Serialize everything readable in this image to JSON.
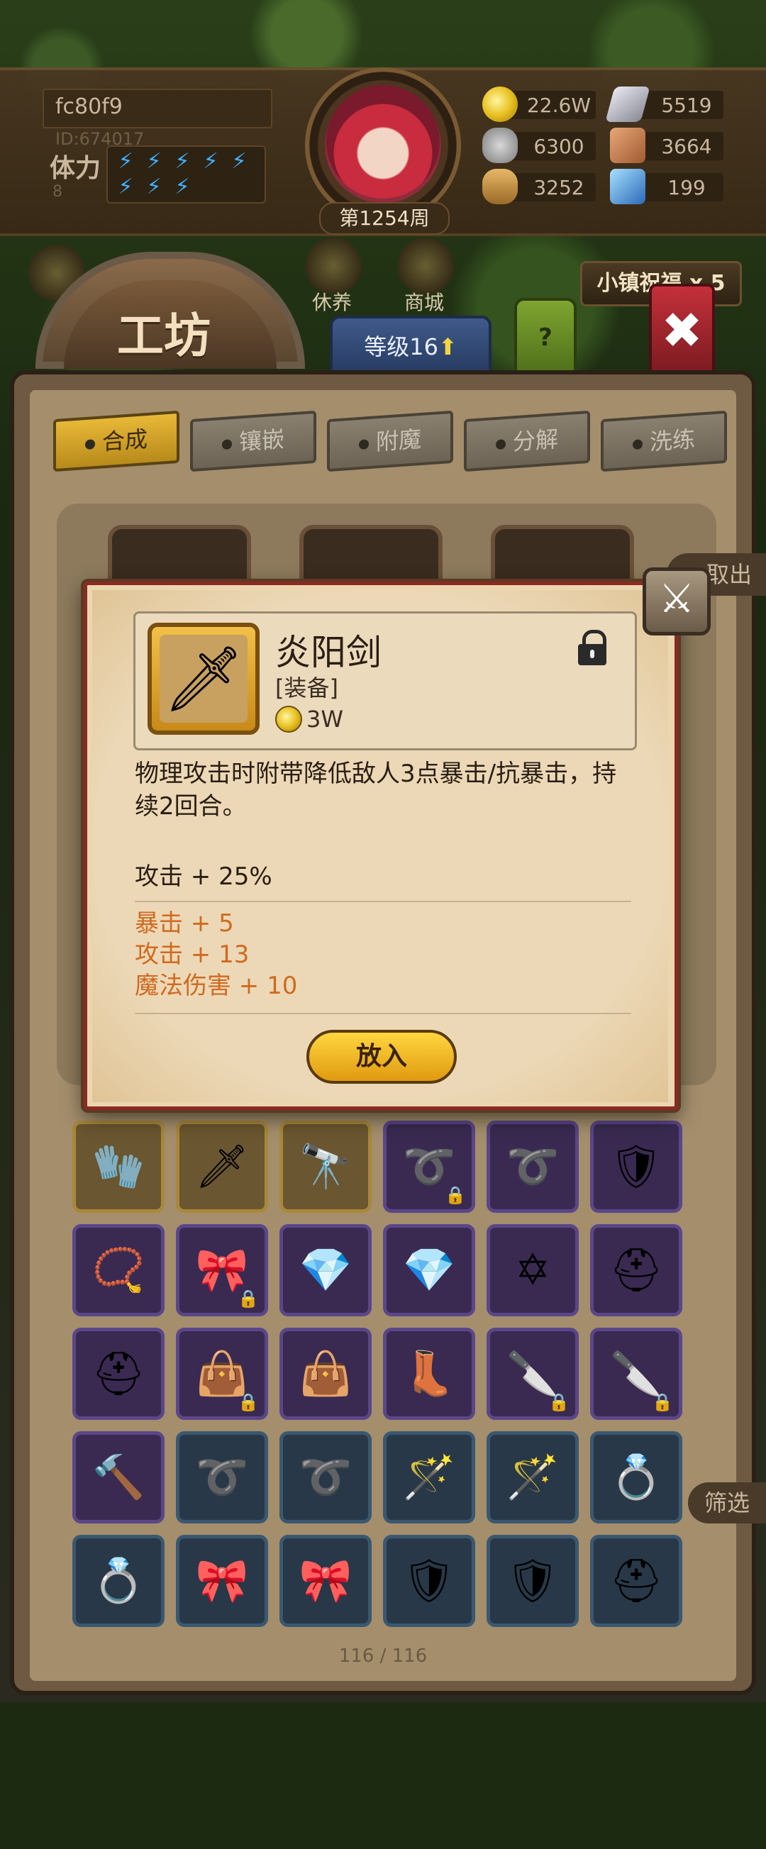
{
  "player": {
    "name": "fc80f9",
    "id_text": "ID:674017",
    "stamina_label": "体力",
    "stamina_value": "8",
    "week_text": "第1254周"
  },
  "resources": [
    {
      "icon": "gold-coin-icon",
      "value": "22.6W"
    },
    {
      "icon": "iron-ingot-icon",
      "value": "5519"
    },
    {
      "icon": "stone-ore-icon",
      "value": "6300"
    },
    {
      "icon": "leather-icon",
      "value": "3664"
    },
    {
      "icon": "wood-log-icon",
      "value": "3252"
    },
    {
      "icon": "crystal-icon",
      "value": "199"
    }
  ],
  "nav": {
    "rest_label": "休养",
    "shop_label": "商城",
    "blessing_label": "小镇祝福 x 5",
    "workshop_title": "工坊",
    "level_label": "等级16",
    "help_label": "?"
  },
  "tabs": [
    {
      "label": "合成",
      "active": true
    },
    {
      "label": "镶嵌",
      "active": false
    },
    {
      "label": "附魔",
      "active": false
    },
    {
      "label": "分解",
      "active": false
    },
    {
      "label": "洗练",
      "active": false
    }
  ],
  "takeout_label": "取出",
  "filter_label": "筛选",
  "inventory_count": "116 / 116",
  "inventory": [
    [
      {
        "icon": "gauntlet-icon",
        "rarity": "gold",
        "locked": false
      },
      {
        "icon": "sword-icon",
        "rarity": "gold",
        "locked": false
      },
      {
        "icon": "telescope-icon",
        "rarity": "gold",
        "locked": false
      },
      {
        "icon": "whip-icon",
        "rarity": "purple",
        "locked": true
      },
      {
        "icon": "whip-icon",
        "rarity": "purple",
        "locked": false
      },
      {
        "icon": "armor-icon",
        "rarity": "purple",
        "locked": false
      }
    ],
    [
      {
        "icon": "necklace-icon",
        "rarity": "purple",
        "locked": false
      },
      {
        "icon": "belt-icon",
        "rarity": "purple",
        "locked": true
      },
      {
        "icon": "crystal-crown-icon",
        "rarity": "purple",
        "locked": false
      },
      {
        "icon": "crystal-crown-icon",
        "rarity": "purple",
        "locked": false
      },
      {
        "icon": "hexagram-amulet-icon",
        "rarity": "purple",
        "locked": false
      },
      {
        "icon": "helmet-icon",
        "rarity": "purple",
        "locked": false
      }
    ],
    [
      {
        "icon": "helmet-icon",
        "rarity": "purple",
        "locked": false
      },
      {
        "icon": "bag-icon",
        "rarity": "purple",
        "locked": true
      },
      {
        "icon": "bag-icon",
        "rarity": "purple",
        "locked": false
      },
      {
        "icon": "winged-boots-icon",
        "rarity": "purple",
        "locked": false
      },
      {
        "icon": "dagger-icon",
        "rarity": "purple",
        "locked": true
      },
      {
        "icon": "dagger-icon",
        "rarity": "purple",
        "locked": true
      }
    ],
    [
      {
        "icon": "hammer-icon",
        "rarity": "purple",
        "locked": false
      },
      {
        "icon": "whip-icon",
        "rarity": "blue",
        "locked": false
      },
      {
        "icon": "whip-icon",
        "rarity": "blue",
        "locked": false
      },
      {
        "icon": "staff-icon",
        "rarity": "blue",
        "locked": false
      },
      {
        "icon": "staff-icon",
        "rarity": "blue",
        "locked": false
      },
      {
        "icon": "ring-icon",
        "rarity": "blue",
        "locked": false
      }
    ],
    [
      {
        "icon": "ring-icon",
        "rarity": "blue",
        "locked": false
      },
      {
        "icon": "belt-icon",
        "rarity": "blue",
        "locked": false
      },
      {
        "icon": "belt-icon",
        "rarity": "blue",
        "locked": false
      },
      {
        "icon": "shield-icon",
        "rarity": "blue",
        "locked": false
      },
      {
        "icon": "shield-icon",
        "rarity": "blue",
        "locked": false
      },
      {
        "icon": "helmet-icon",
        "rarity": "blue",
        "locked": false
      }
    ]
  ],
  "popup": {
    "item_name": "炎阳剑",
    "item_type": "[装备]",
    "item_price": "3W",
    "description": "物理攻击时附带降低敌人3点暴击/抗暴击，持续2回合。",
    "main_stat": "攻击 + 25%",
    "bonus_stats": [
      "暴击 + 5",
      "攻击 + 13",
      "魔法伤害 + 10"
    ],
    "bonus_color": "#d06a20",
    "put_button": "放入"
  }
}
